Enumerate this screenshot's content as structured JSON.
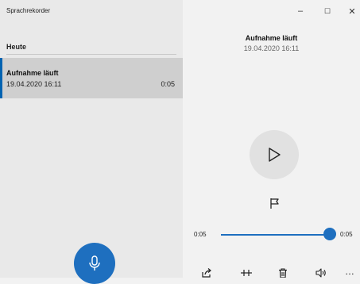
{
  "app": {
    "title": "Sprachrekorder"
  },
  "sidebar": {
    "section_label": "Heute",
    "items": [
      {
        "title": "Aufnahme läuft",
        "date": "19.04.2020 16:11",
        "duration": "0:05"
      }
    ]
  },
  "window_controls": {
    "minimize": "–",
    "maximize": "☐",
    "close": "✕"
  },
  "detail": {
    "title": "Aufnahme läuft",
    "date": "19.04.2020 16:11"
  },
  "playback": {
    "current_time": "0:05",
    "total_time": "0:05",
    "progress": 1.0
  },
  "toolbar": {
    "more_label": "…"
  },
  "colors": {
    "accent": "#1e6fbf",
    "selected_bg": "#cfcfcf"
  },
  "icons": [
    "microphone-icon",
    "play-icon",
    "flag-icon",
    "share-icon",
    "trim-icon",
    "delete-icon",
    "volume-icon",
    "more-icon"
  ]
}
